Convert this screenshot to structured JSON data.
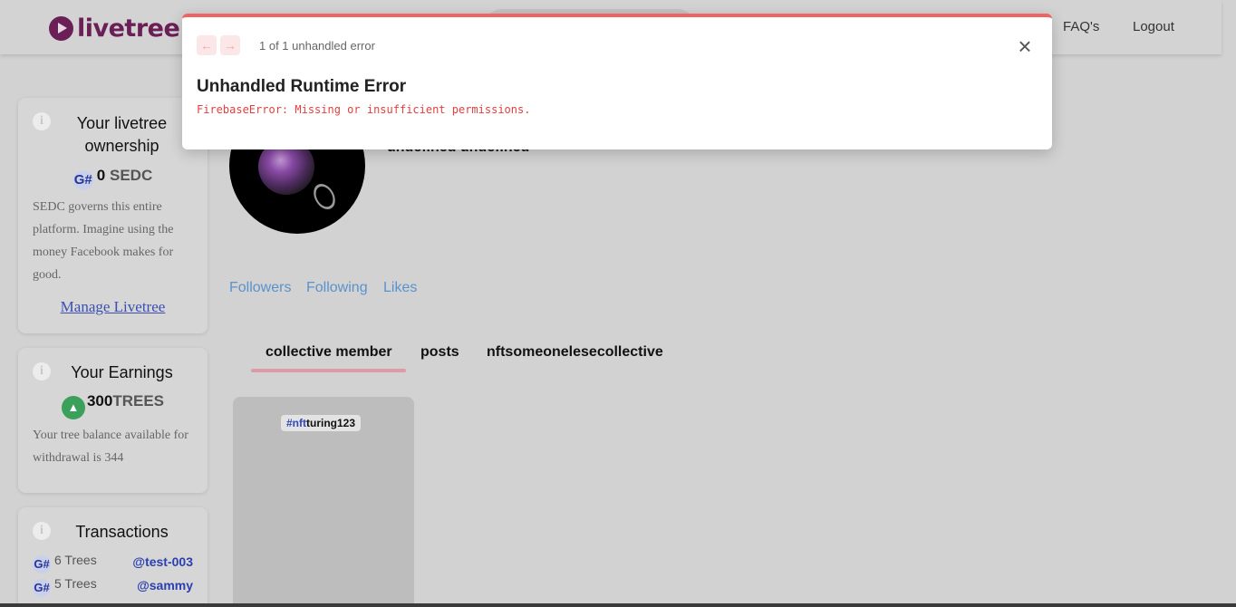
{
  "header": {
    "logo_text": "livetree",
    "nav": {
      "faq": "FAQ's",
      "logout": "Logout"
    }
  },
  "sidebar": {
    "ownership": {
      "title": "Your livetree ownership",
      "currency_icon": "G#",
      "amount": "0",
      "unit": "SEDC",
      "description": "SEDC governs this entire platform. Imagine using the money Facebook makes for good.",
      "link": "Manage Livetree"
    },
    "earnings": {
      "title": "Your Earnings",
      "amount": "300",
      "unit": "TREES",
      "description": "Your tree balance available for withdrawal is 344"
    },
    "transactions": {
      "title": "Transactions",
      "currency_icon": "G#",
      "items": [
        {
          "amount": "6 Trees",
          "user": "@test-003"
        },
        {
          "amount": "5 Trees",
          "user": "@sammy"
        }
      ]
    }
  },
  "profile": {
    "name": "undefined undefined",
    "stats": {
      "followers": "Followers",
      "following": "Following",
      "likes": "Likes"
    },
    "tabs": [
      "collective member",
      "posts",
      "nftsomeonelesecollective"
    ],
    "active_tab": "collective member",
    "post_tag": {
      "hash": "#nft",
      "rest": "turing123"
    }
  },
  "error_overlay": {
    "count_text": "1 of 1 unhandled error",
    "title": "Unhandled Runtime Error",
    "message": "FirebaseError: Missing or insufficient permissions."
  },
  "colors": {
    "brand": "#6a1f56",
    "error_accent": "#ef6363",
    "link": "#5a93cc",
    "tab_underline": "#df9aa8"
  }
}
